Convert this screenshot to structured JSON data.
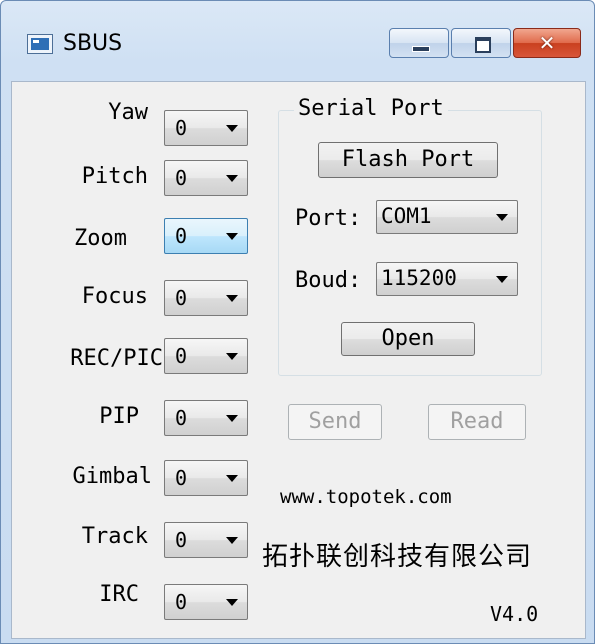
{
  "window": {
    "title": "SBUS",
    "close_glyph": "✕"
  },
  "controls": [
    {
      "label": "Yaw",
      "value": "0"
    },
    {
      "label": "Pitch",
      "value": "0"
    },
    {
      "label": "Zoom",
      "value": "0"
    },
    {
      "label": "Focus",
      "value": "0"
    },
    {
      "label": "REC/PIC",
      "value": "0"
    },
    {
      "label": "PIP",
      "value": "0"
    },
    {
      "label": "Gimbal",
      "value": "0"
    },
    {
      "label": "Track",
      "value": "0"
    },
    {
      "label": "IRC",
      "value": "0"
    }
  ],
  "serial_port": {
    "group_title": "Serial Port",
    "flash_button": "Flash Port",
    "port_label": "Port:",
    "port_value": "COM1",
    "baud_label": "Boud:",
    "baud_value": "115200",
    "open_button": "Open"
  },
  "actions": {
    "send_button": "Send",
    "read_button": "Read"
  },
  "footer": {
    "website": "www.topotek.com",
    "company": "拓扑联创科技有限公司",
    "version": "V4.0"
  },
  "colors": {
    "focused_combo": "#bee6fd",
    "disabled_text": "#a0a0a0",
    "close_button": "#c9401f"
  }
}
